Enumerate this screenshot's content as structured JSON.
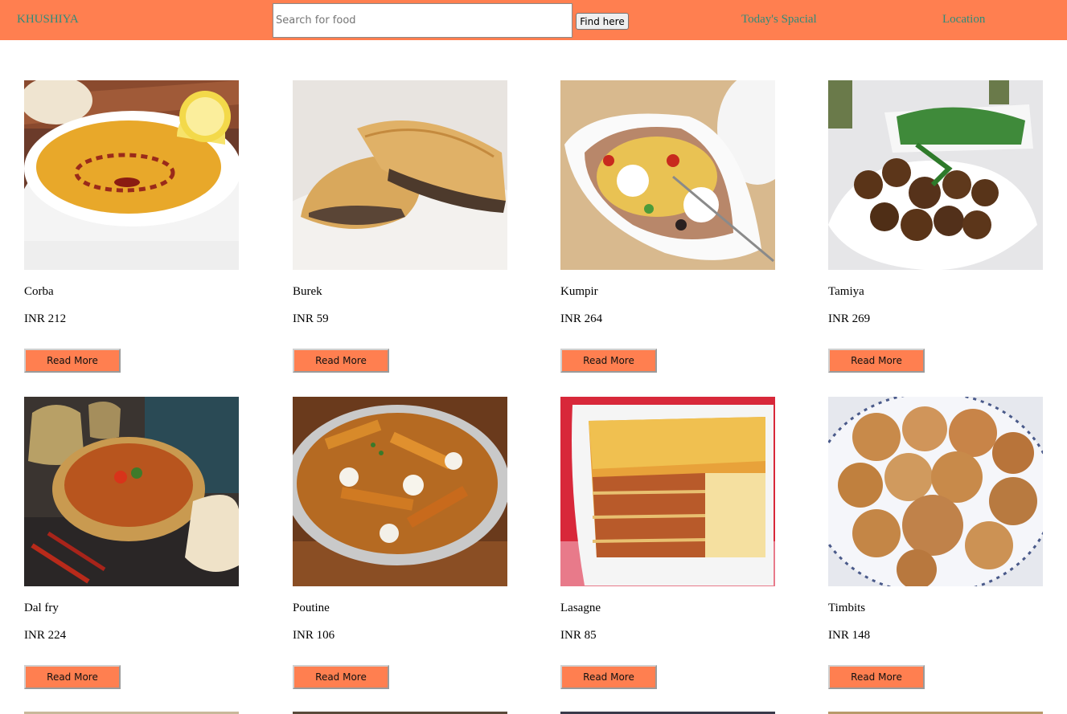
{
  "navbar": {
    "brand": "KHUSHIYA",
    "search_placeholder": "Search for food",
    "search_value": "",
    "find_label": "Find here",
    "links": [
      "Today's Spacial",
      "Location"
    ],
    "background": "#ff7f50",
    "link_color": "#2e8b7a"
  },
  "items": [
    {
      "name": "Corba",
      "price": "INR 212",
      "button": "Read More",
      "image": "lentil-soup-bowl-with-lemon"
    },
    {
      "name": "Burek",
      "price": "INR 59",
      "button": "Read More",
      "image": "meat-filled-pastry-on-plate"
    },
    {
      "name": "Kumpir",
      "price": "INR 264",
      "button": "Read More",
      "image": "stuffed-baked-potato"
    },
    {
      "name": "Tamiya",
      "price": "INR 269",
      "button": "Read More",
      "image": "falafel-with-salad"
    },
    {
      "name": "Dal fry",
      "price": "INR 224",
      "button": "Read More",
      "image": "dal-in-copper-pot-with-bread"
    },
    {
      "name": "Poutine",
      "price": "INR 106",
      "button": "Read More",
      "image": "fries-with-gravy-and-cheese-curds"
    },
    {
      "name": "Lasagne",
      "price": "INR 85",
      "button": "Read More",
      "image": "lasagne-in-baking-dish"
    },
    {
      "name": "Timbits",
      "price": "INR 148",
      "button": "Read More",
      "image": "sugar-dusted-donut-holes"
    }
  ],
  "button_color": "#ff7f50"
}
